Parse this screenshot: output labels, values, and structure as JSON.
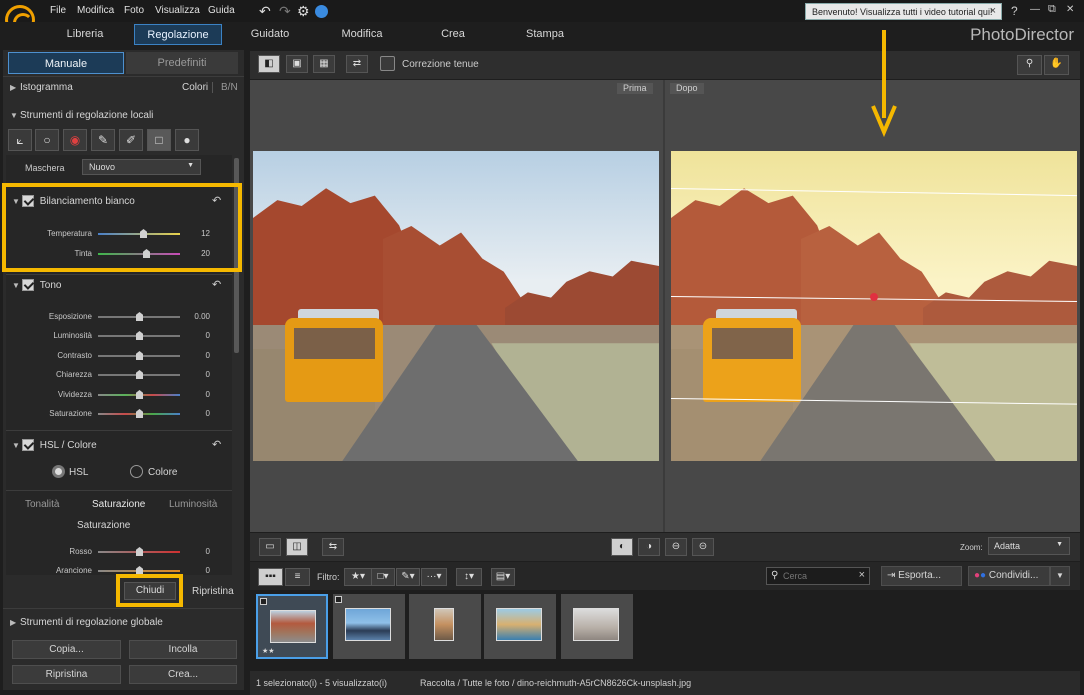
{
  "menu": {
    "items": [
      "File",
      "Modifica",
      "Foto",
      "Visualizza",
      "Guida"
    ]
  },
  "welcome": {
    "text": "Benvenuto! Visualizza tutti i video tutorial qui!",
    "close": "×"
  },
  "window_controls": {
    "help": "?",
    "minimize": "—",
    "restore": "⧉",
    "close": "✕"
  },
  "modules": {
    "tabs": [
      "Libreria",
      "Regolazione",
      "Guidato",
      "Modifica",
      "Crea",
      "Stampa"
    ],
    "active": "Regolazione"
  },
  "brand": "PhotoDirector",
  "left_panel": {
    "tabs": {
      "manual": "Manuale",
      "presets": "Predefiniti"
    },
    "histogram": {
      "label": "Istogramma",
      "colors": "Colori",
      "bw": "B/N"
    },
    "local_tools": {
      "label": "Strumenti di regolazione locali"
    },
    "mask": {
      "label": "Maschera",
      "value": "Nuovo"
    },
    "white_balance": {
      "label": "Bilanciamento bianco",
      "sliders": [
        {
          "label": "Temperatura",
          "value": "12"
        },
        {
          "label": "Tinta",
          "value": "20"
        }
      ]
    },
    "tone": {
      "label": "Tono",
      "sliders": [
        {
          "label": "Esposizione",
          "value": "0.00"
        },
        {
          "label": "Luminosità",
          "value": "0"
        },
        {
          "label": "Contrasto",
          "value": "0"
        },
        {
          "label": "Chiarezza",
          "value": "0"
        },
        {
          "label": "Vividezza",
          "value": "0"
        },
        {
          "label": "Saturazione",
          "value": "0"
        }
      ]
    },
    "hsl": {
      "label": "HSL / Colore",
      "radio_hsl": "HSL",
      "radio_color": "Colore",
      "subtabs": [
        "Tonalità",
        "Saturazione",
        "Luminosità"
      ],
      "section_title": "Saturazione",
      "sliders": [
        {
          "label": "Rosso",
          "value": "0"
        },
        {
          "label": "Arancione",
          "value": "0"
        }
      ]
    },
    "close_btn": "Chiudi",
    "reset_btn": "Ripristina",
    "global_tools": {
      "label": "Strumenti di regolazione globale"
    },
    "buttons": {
      "copy": "Copia...",
      "paste": "Incolla",
      "reset": "Ripristina",
      "create": "Crea..."
    }
  },
  "view": {
    "soft_proof": "Correzione tenue",
    "before": "Prima",
    "after": "Dopo"
  },
  "bottom": {
    "zoom_label": "Zoom:",
    "zoom_value": "Adatta",
    "filter_label": "Filtro:",
    "search_placeholder": "Cerca",
    "export": "Esporta...",
    "share": "Condividi..."
  },
  "status": {
    "selection": "1 selezionato(i) - 5 visualizzato(i)",
    "path": "Raccolta / Tutte le foto / dino-reichmuth-A5rCN8626Ck-unsplash.jpg"
  },
  "thumbnail_rating": "★★",
  "colors": {
    "accent": "#3b82c4",
    "highlight": "#f5b800",
    "logo": "#f0a000"
  }
}
